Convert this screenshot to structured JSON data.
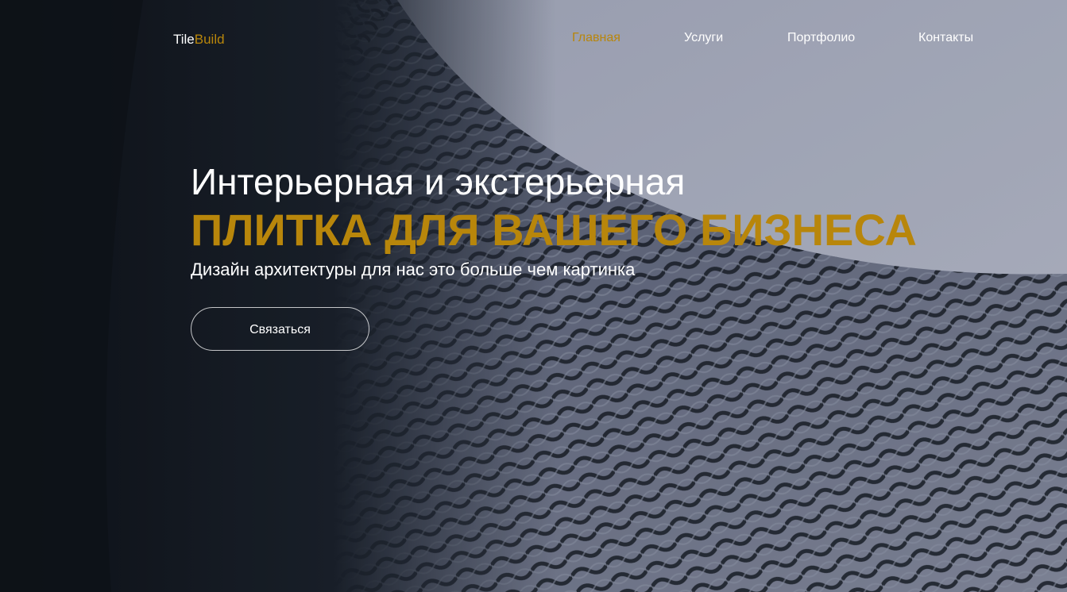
{
  "logo": {
    "part1": "Tile",
    "part2": "Build"
  },
  "nav": {
    "items": [
      {
        "label": "Главная",
        "active": true
      },
      {
        "label": "Услуги",
        "active": false
      },
      {
        "label": "Портфолио",
        "active": false
      },
      {
        "label": "Контакты",
        "active": false
      }
    ]
  },
  "hero": {
    "title_line1": "Интерьерная и экстерьерная",
    "title_line2": "ПЛИТКА ДЛЯ ВАШЕГО БИЗНЕСА",
    "subtitle": "Дизайн архитектуры для нас это больше чем картинка",
    "cta_label": "Связаться",
    "background": "architectural-facade-photo"
  },
  "colors": {
    "accent": "#b8860b",
    "text": "#ffffff",
    "dark_bg": "#141a22",
    "sky": "#aab1c6"
  }
}
